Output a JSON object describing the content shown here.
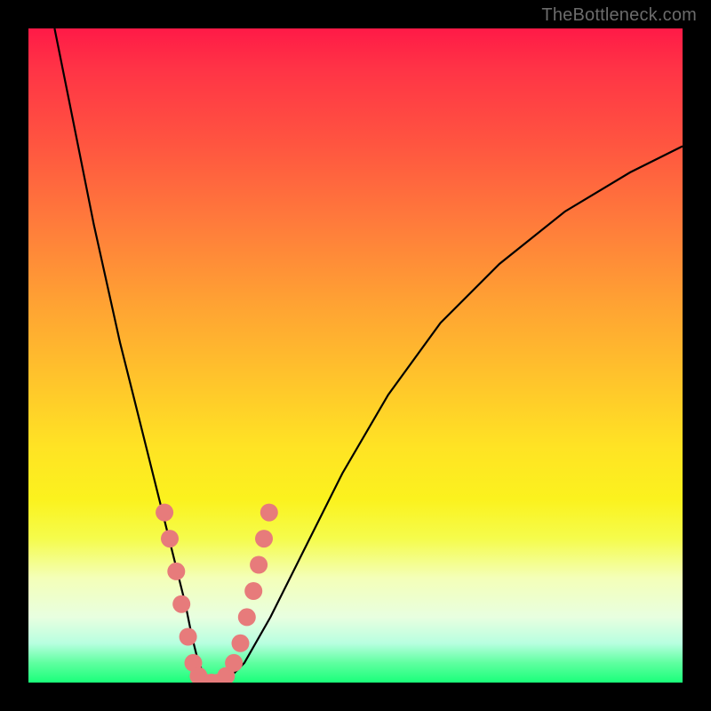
{
  "attribution": "TheBottleneck.com",
  "colors": {
    "frame": "#000000",
    "gradient_top": "#ff1a47",
    "gradient_bottom": "#1aff7a",
    "curve": "#000000",
    "marker_fill": "#e77b7b",
    "marker_stroke": "#cf5a5a"
  },
  "chart_data": {
    "type": "line",
    "title": "",
    "xlabel": "",
    "ylabel": "",
    "xlim": [
      0,
      100
    ],
    "ylim": [
      0,
      100
    ],
    "series": [
      {
        "name": "bottleneck-curve",
        "x": [
          4,
          6,
          8,
          10,
          12,
          14,
          16,
          18,
          20,
          22,
          24,
          25,
          26,
          27,
          28,
          30,
          33,
          37,
          42,
          48,
          55,
          63,
          72,
          82,
          92,
          100
        ],
        "y": [
          100,
          90,
          80,
          70,
          61,
          52,
          44,
          36,
          28,
          20,
          12,
          7,
          3,
          1,
          0,
          0,
          3,
          10,
          20,
          32,
          44,
          55,
          64,
          72,
          78,
          82
        ]
      }
    ],
    "markers": {
      "name": "highlight-dots",
      "x_min": 20.5,
      "x_max": 36,
      "points": [
        {
          "x": 20.8,
          "y": 26
        },
        {
          "x": 21.6,
          "y": 22
        },
        {
          "x": 22.6,
          "y": 17
        },
        {
          "x": 23.4,
          "y": 12
        },
        {
          "x": 24.4,
          "y": 7
        },
        {
          "x": 25.2,
          "y": 3
        },
        {
          "x": 26.0,
          "y": 1
        },
        {
          "x": 27.0,
          "y": 0
        },
        {
          "x": 28.0,
          "y": 0
        },
        {
          "x": 29.0,
          "y": 0
        },
        {
          "x": 30.2,
          "y": 1
        },
        {
          "x": 31.4,
          "y": 3
        },
        {
          "x": 32.4,
          "y": 6
        },
        {
          "x": 33.4,
          "y": 10
        },
        {
          "x": 34.4,
          "y": 14
        },
        {
          "x": 35.2,
          "y": 18
        },
        {
          "x": 36.0,
          "y": 22
        },
        {
          "x": 36.8,
          "y": 26
        }
      ]
    }
  }
}
